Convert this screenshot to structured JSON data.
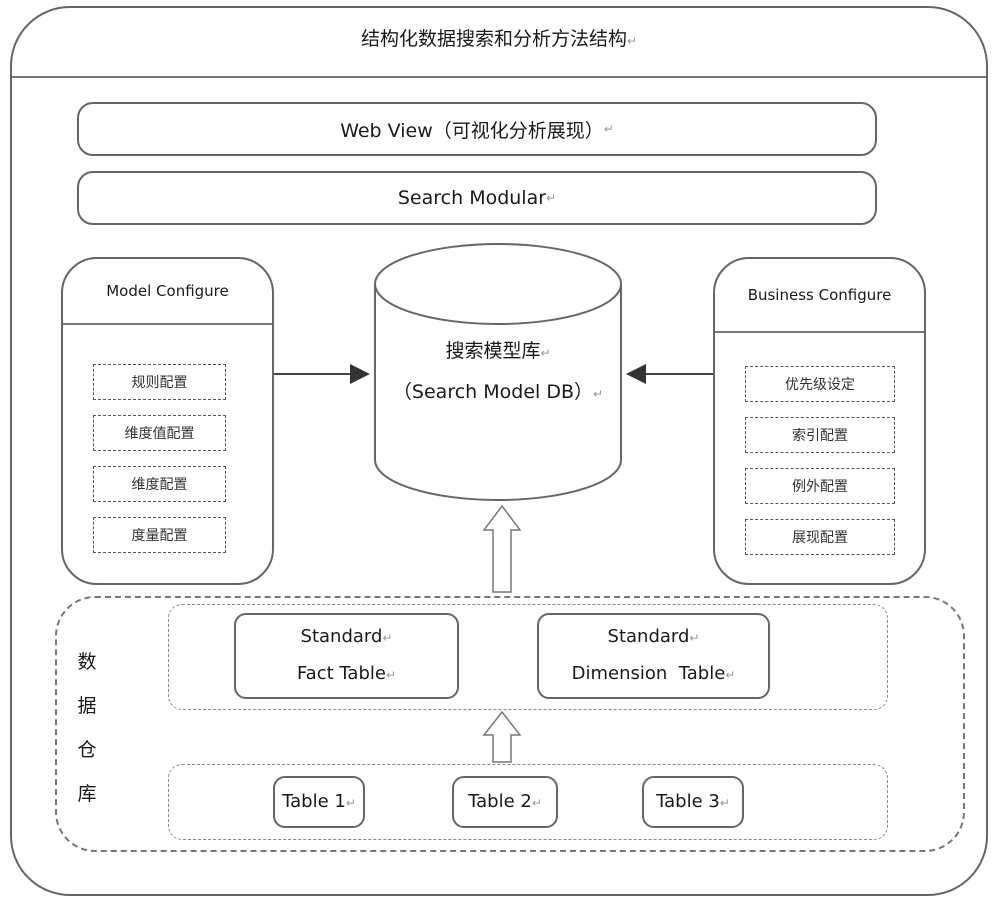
{
  "title": "结构化数据搜索和分析方法结构",
  "web_view": "Web View（可视化分析展现）",
  "search_modular": "Search Modular",
  "model_configure": {
    "title": "Model Configure",
    "items": [
      "规则配置",
      "维度值配置",
      "维度配置",
      "度量配置"
    ]
  },
  "business_configure": {
    "title": "Business Configure",
    "items": [
      "优先级设定",
      "索引配置",
      "例外配置",
      "展现配置"
    ]
  },
  "search_model_db": {
    "line1": "搜索模型库",
    "line2": "（Search Model DB）"
  },
  "data_warehouse": {
    "label_chars": [
      "数",
      "据",
      "仓",
      "库"
    ],
    "fact_table": {
      "line1": "Standard",
      "line2": "Fact Table"
    },
    "dimension_table": {
      "line1": "Standard",
      "line2": "Dimension  Table"
    },
    "tables": [
      "Table 1",
      "Table 2",
      "Table 3"
    ]
  },
  "return_mark": "↵"
}
